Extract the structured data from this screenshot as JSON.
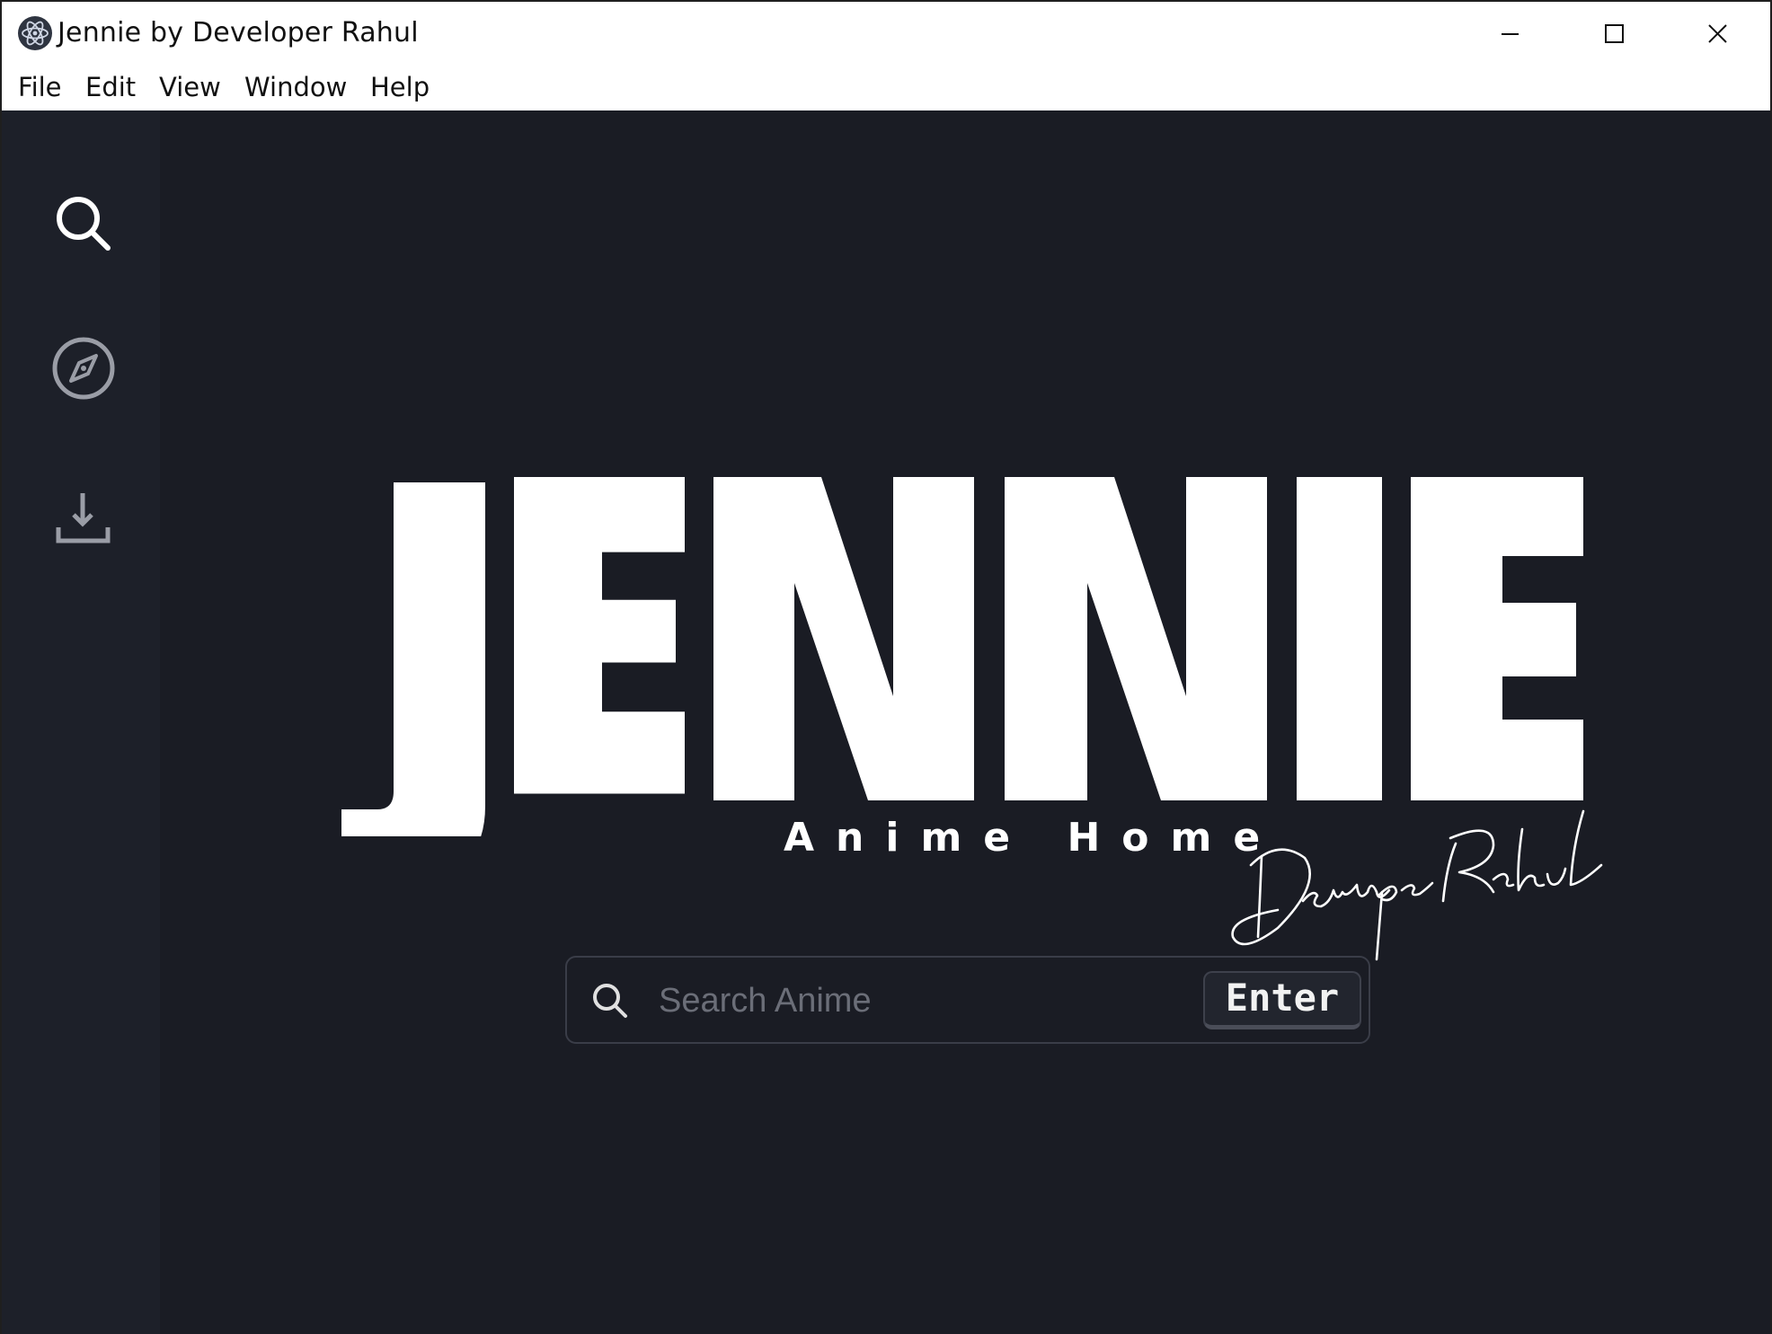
{
  "window": {
    "title": "Jennie by Developer Rahul",
    "app_icon": "electron-atom-icon",
    "controls": [
      "minimize-icon",
      "maximize-icon",
      "close-icon"
    ]
  },
  "menu": {
    "items": [
      "File",
      "Edit",
      "View",
      "Window",
      "Help"
    ]
  },
  "sidebar": {
    "items": [
      {
        "name": "search",
        "icon": "search-icon"
      },
      {
        "name": "explore",
        "icon": "compass-icon"
      },
      {
        "name": "downloads",
        "icon": "download-icon"
      }
    ]
  },
  "hero": {
    "logo_text": "JENNIE",
    "subtitle": "Anime Home",
    "signature": "Developer Rahul"
  },
  "search": {
    "placeholder": "Search Anime",
    "value": "",
    "button_label": "Enter"
  },
  "colors": {
    "background": "#1a1c24",
    "sidebar": "#1d2029",
    "text": "#ffffff",
    "titlebar": "#ffffff"
  }
}
